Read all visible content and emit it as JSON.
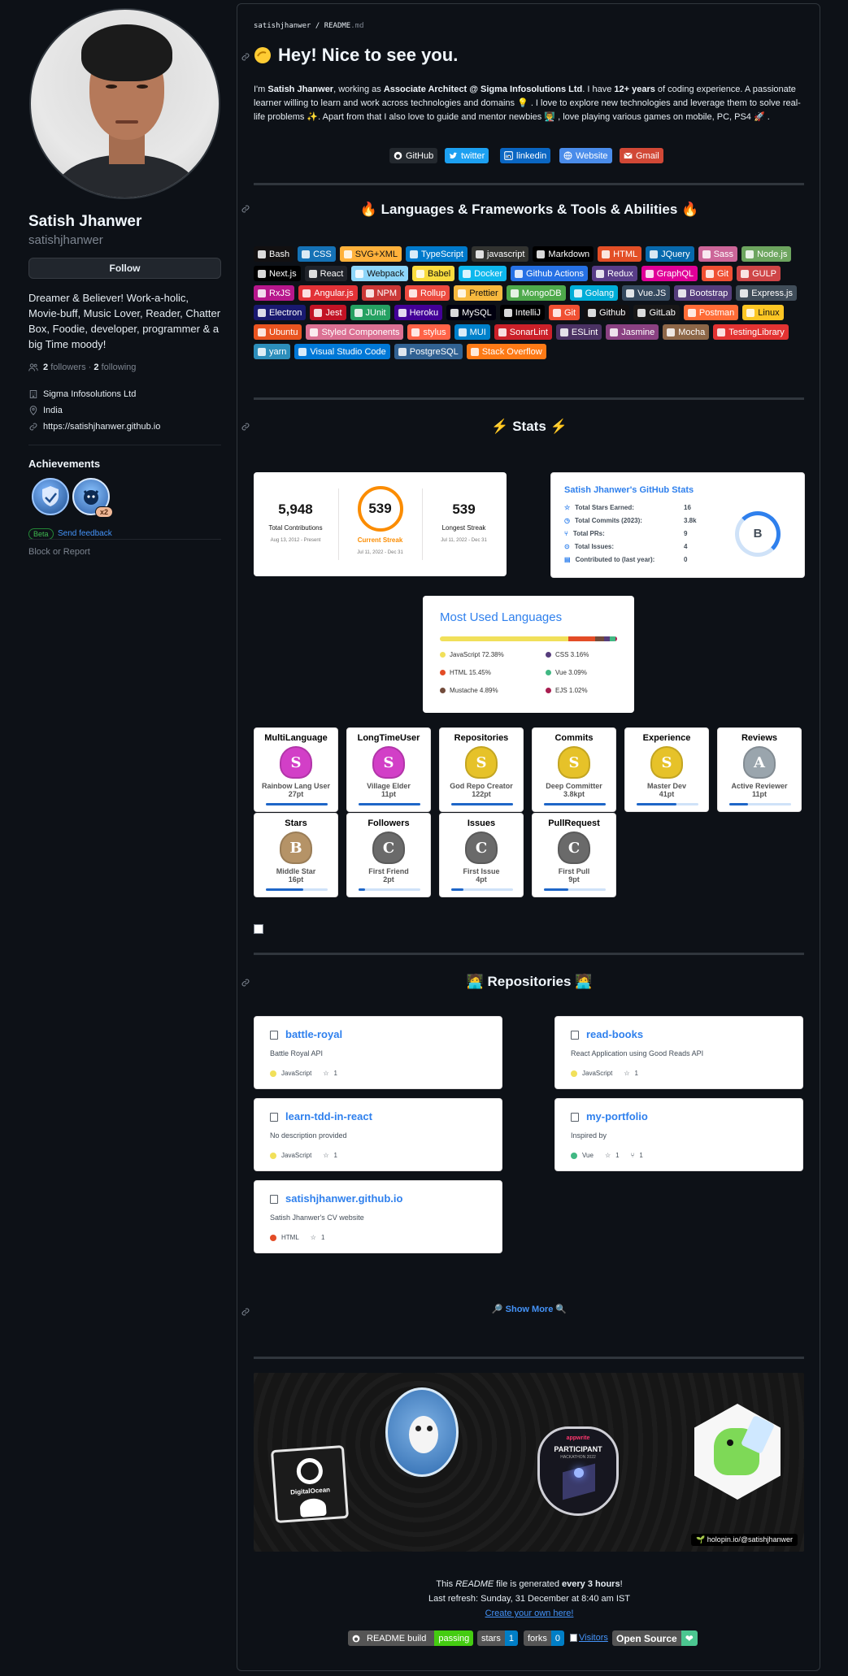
{
  "profile": {
    "name": "Satish Jhanwer",
    "login": "satishjhanwer",
    "follow_label": "Follow",
    "bio": "Dreamer & Believer! Work-a-holic, Movie-buff, Music Lover, Reader, Chatter Box, Foodie, developer, programmer & a big Time moody!",
    "followers_count": "2",
    "followers_label": "followers",
    "dot": "·",
    "following_count": "2",
    "following_label": "following",
    "company": "Sigma Infosolutions Ltd",
    "location": "India",
    "website": "https://satishjhanwer.github.io",
    "achievements_title": "Achievements",
    "achievement_count": "x2",
    "beta_label": "Beta",
    "feedback_label": "Send feedback",
    "block_label": "Block or Report"
  },
  "readme": {
    "breadcrumb_user": "satishjhanwer",
    "breadcrumb_sep": "/",
    "breadcrumb_file": "README",
    "breadcrumb_ext": ".md",
    "heading": "Hey! Nice to see you.",
    "intro": {
      "p1": "I'm ",
      "name": "Satish Jhanwer",
      "p2": ", working as ",
      "role": "Associate Architect @ Sigma Infosolutions Ltd",
      "p3": ". I have ",
      "years": "12+ years",
      "p4": " of coding experience. A passionate learner willing to learn and work across technologies and domains 💡 . I love to explore new technologies and leverage them to solve real-life problems ✨. Apart from that I also love to guide and mentor newbies 👨‍🏫 , love playing various games on mobile, PC, PS4 🚀 ."
    },
    "social": [
      {
        "label": "GitHub",
        "color": "#24292f"
      },
      {
        "label": "twitter",
        "color": "#1ca0f1"
      },
      {
        "label": "linkedin",
        "color": "#0a66c2"
      },
      {
        "label": "Website",
        "color": "#4a8cea"
      },
      {
        "label": "Gmail",
        "color": "#d14836"
      }
    ],
    "skills_heading": "Languages & Frameworks & Tools & Abilities",
    "skills": [
      {
        "label": "Bash",
        "color": "#121011"
      },
      {
        "label": "CSS",
        "color": "#1572b6"
      },
      {
        "label": "SVG+XML",
        "color": "#ffb13b"
      },
      {
        "label": "TypeScript",
        "color": "#007acc"
      },
      {
        "label": "javascript",
        "color": "#323330"
      },
      {
        "label": "Markdown",
        "color": "#000000"
      },
      {
        "label": "HTML",
        "color": "#e34f26"
      },
      {
        "label": "JQuery",
        "color": "#0769ad"
      },
      {
        "label": "Sass",
        "color": "#cc6699"
      },
      {
        "label": "Node.js",
        "color": "#6da55f"
      },
      {
        "label": "Next.js",
        "color": "#000000"
      },
      {
        "label": "React",
        "color": "#20232a"
      },
      {
        "label": "Webpack",
        "color": "#8dd6f9"
      },
      {
        "label": "Babel",
        "color": "#f9dc3e"
      },
      {
        "label": "Docker",
        "color": "#0db7ed"
      },
      {
        "label": "Github Actions",
        "color": "#2671e5"
      },
      {
        "label": "Redux",
        "color": "#593d88"
      },
      {
        "label": "GraphQL",
        "color": "#e10098"
      },
      {
        "label": "Git",
        "color": "#f05033"
      },
      {
        "label": "GULP",
        "color": "#cf4647"
      },
      {
        "label": "RxJS",
        "color": "#b7178c"
      },
      {
        "label": "Angular.js",
        "color": "#e23237"
      },
      {
        "label": "NPM",
        "color": "#cb3837"
      },
      {
        "label": "Rollup",
        "color": "#ec4a3f"
      },
      {
        "label": "Prettier",
        "color": "#f7b93e"
      },
      {
        "label": "MongoDB",
        "color": "#4ea94b"
      },
      {
        "label": "Golang",
        "color": "#00add8"
      },
      {
        "label": "Vue.JS",
        "color": "#35495e"
      },
      {
        "label": "Bootstrap",
        "color": "#563d7c"
      },
      {
        "label": "Express.js",
        "color": "#404d59"
      },
      {
        "label": "Electron",
        "color": "#191970"
      },
      {
        "label": "Jest",
        "color": "#c21325"
      },
      {
        "label": "JUnit",
        "color": "#25a162"
      },
      {
        "label": "Heroku",
        "color": "#430098"
      },
      {
        "label": "MySQL",
        "color": "#00000f"
      },
      {
        "label": "IntelliJ",
        "color": "#000000"
      },
      {
        "label": "Git",
        "color": "#f05032"
      },
      {
        "label": "Github",
        "color": "#121011"
      },
      {
        "label": "GitLab",
        "color": "#181717"
      },
      {
        "label": "Postman",
        "color": "#ff6c37"
      },
      {
        "label": "Linux",
        "color": "#fcc624"
      },
      {
        "label": "Ubuntu",
        "color": "#e95420"
      },
      {
        "label": "Styled Components",
        "color": "#db7093"
      },
      {
        "label": "stylus",
        "color": "#ff6347"
      },
      {
        "label": "MUI",
        "color": "#0081cb"
      },
      {
        "label": "SonarLint",
        "color": "#cb2029"
      },
      {
        "label": "ESLint",
        "color": "#4b3263"
      },
      {
        "label": "Jasmine",
        "color": "#8a4182"
      },
      {
        "label": "Mocha",
        "color": "#8d6748"
      },
      {
        "label": "TestingLibrary",
        "color": "#e33332"
      },
      {
        "label": "yarn",
        "color": "#2c8ebb"
      },
      {
        "label": "Visual Studio Code",
        "color": "#0078d7"
      },
      {
        "label": "PostgreSQL",
        "color": "#316192"
      },
      {
        "label": "Stack Overflow",
        "color": "#fe7a16"
      }
    ],
    "stats_heading": "Stats",
    "streak": {
      "total": "5,948",
      "total_label": "Total Contributions",
      "total_range": "Aug 13, 2012 - Present",
      "current": "539",
      "current_label": "Current Streak",
      "current_range": "Jul 11, 2022 - Dec 31",
      "longest": "539",
      "longest_label": "Longest Streak",
      "longest_range": "Jul 11, 2022 - Dec 31"
    },
    "gh_stats": {
      "title": "Satish Jhanwer's GitHub Stats",
      "rows": [
        {
          "label": "Total Stars Earned:",
          "value": "16"
        },
        {
          "label": "Total Commits (2023):",
          "value": "3.8k"
        },
        {
          "label": "Total PRs:",
          "value": "9"
        },
        {
          "label": "Total Issues:",
          "value": "4"
        },
        {
          "label": "Contributed to (last year):",
          "value": "0"
        }
      ],
      "rank": "B"
    },
    "langs": {
      "title": "Most Used Languages",
      "items": [
        {
          "label": "JavaScript 72.38%",
          "color": "#f1e05a",
          "value": 72.38
        },
        {
          "label": "CSS 3.16%",
          "color": "#563d7c",
          "value": 3.16
        },
        {
          "label": "HTML 15.45%",
          "color": "#e34c26",
          "value": 15.45
        },
        {
          "label": "Vue 3.09%",
          "color": "#41b883",
          "value": 3.09
        },
        {
          "label": "Mustache 4.89%",
          "color": "#724b3b",
          "value": 4.89
        },
        {
          "label": "EJS 1.02%",
          "color": "#a91e50",
          "value": 1.02
        }
      ]
    },
    "trophies": [
      {
        "title": "MultiLanguage",
        "rank": "S",
        "name": "Rainbow Lang User",
        "pt": "27pt",
        "color": "#d23fc7",
        "progress": 1.0
      },
      {
        "title": "LongTimeUser",
        "rank": "S",
        "name": "Village Elder",
        "pt": "11pt",
        "color": "#d23fc7",
        "progress": 1.0
      },
      {
        "title": "Repositories",
        "rank": "S",
        "name": "God Repo Creator",
        "pt": "122pt",
        "color": "#e6c229",
        "progress": 1.0
      },
      {
        "title": "Commits",
        "rank": "S",
        "name": "Deep Committer",
        "pt": "3.8kpt",
        "color": "#e6c229",
        "progress": 1.0
      },
      {
        "title": "Experience",
        "rank": "S",
        "name": "Master Dev",
        "pt": "41pt",
        "color": "#e6c229",
        "progress": 0.65
      },
      {
        "title": "Reviews",
        "rank": "A",
        "name": "Active Reviewer",
        "pt": "11pt",
        "color": "#9aa5ad",
        "progress": 0.3
      },
      {
        "title": "Stars",
        "rank": "B",
        "name": "Middle Star",
        "pt": "16pt",
        "color": "#b59367",
        "progress": 0.6
      },
      {
        "title": "Followers",
        "rank": "C",
        "name": "First Friend",
        "pt": "2pt",
        "color": "#6a6a6a",
        "progress": 0.1
      },
      {
        "title": "Issues",
        "rank": "C",
        "name": "First Issue",
        "pt": "4pt",
        "color": "#6a6a6a",
        "progress": 0.2
      },
      {
        "title": "PullRequest",
        "rank": "C",
        "name": "First Pull",
        "pt": "9pt",
        "color": "#6a6a6a",
        "progress": 0.4
      }
    ],
    "repos_heading": "Repositories",
    "repos": [
      {
        "name": "battle-royal",
        "desc": "Battle Royal API",
        "lang": "JavaScript",
        "color": "#f1e05a",
        "stars": "1",
        "forks": ""
      },
      {
        "name": "read-books",
        "desc": "React Application using Good Reads API",
        "lang": "JavaScript",
        "color": "#f1e05a",
        "stars": "1",
        "forks": ""
      },
      {
        "name": "learn-tdd-in-react",
        "desc": "No description provided",
        "lang": "JavaScript",
        "color": "#f1e05a",
        "stars": "1",
        "forks": ""
      },
      {
        "name": "my-portfolio",
        "desc": "Inspired by",
        "lang": "Vue",
        "color": "#41b883",
        "stars": "1",
        "forks": "1"
      },
      {
        "name": "satishjhanwer.github.io",
        "desc": "Satish Jhanwer's CV website",
        "lang": "HTML",
        "color": "#e34c26",
        "stars": "1",
        "forks": ""
      }
    ],
    "show_more": "🔎 Show More 🔍",
    "holopin_tag": "holopin.io/@satishjhanwer",
    "holopin_badges": {
      "digitalocean": "DigitalOcean",
      "appwrite": "appwrite",
      "participant": "PARTICIPANT",
      "hackathon": "HACKATHON 2022"
    },
    "footer": {
      "l1a": "This ",
      "l1b": "README",
      "l1c": " file is generated ",
      "l1d": "every 3 hours",
      "l1e": "!",
      "l2": "Last refresh: Sunday, 31 December at 8:40 am IST",
      "l3": "Create your own here!"
    },
    "shields": {
      "build": "README build",
      "build_status": "passing",
      "stars": "stars",
      "stars_count": "1",
      "forks": "forks",
      "forks_count": "0",
      "visitors": "Visitors",
      "open_source": "Open Source",
      "heart": "❤"
    }
  }
}
